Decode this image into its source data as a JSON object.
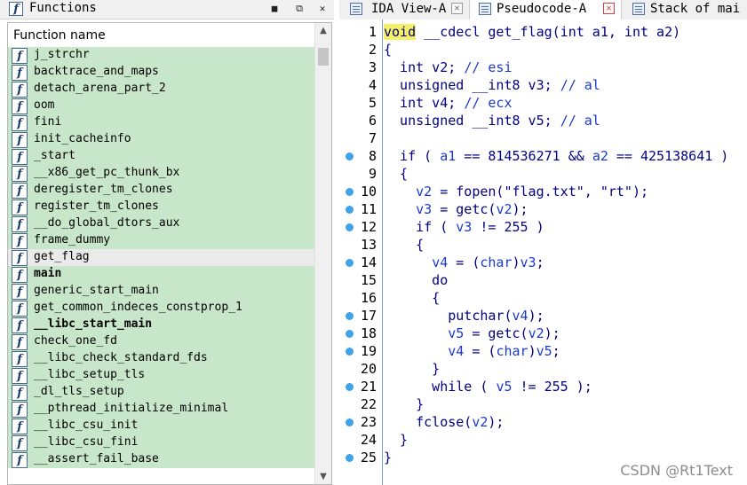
{
  "left_panel": {
    "title": "Functions",
    "column_header": "Function name",
    "icon_glyph": "f",
    "functions": [
      {
        "name": "j_strchr",
        "bold": false
      },
      {
        "name": "backtrace_and_maps",
        "bold": false
      },
      {
        "name": "detach_arena_part_2",
        "bold": false
      },
      {
        "name": "oom",
        "bold": false
      },
      {
        "name": "fini",
        "bold": false
      },
      {
        "name": "init_cacheinfo",
        "bold": false
      },
      {
        "name": "_start",
        "bold": false
      },
      {
        "name": "__x86_get_pc_thunk_bx",
        "bold": false
      },
      {
        "name": "deregister_tm_clones",
        "bold": false
      },
      {
        "name": "register_tm_clones",
        "bold": false
      },
      {
        "name": "__do_global_dtors_aux",
        "bold": false
      },
      {
        "name": "frame_dummy",
        "bold": false
      },
      {
        "name": "get_flag",
        "bold": false,
        "selected": true
      },
      {
        "name": "main",
        "bold": true
      },
      {
        "name": "generic_start_main",
        "bold": false
      },
      {
        "name": "get_common_indeces_constprop_1",
        "bold": false
      },
      {
        "name": "__libc_start_main",
        "bold": true
      },
      {
        "name": "check_one_fd",
        "bold": false
      },
      {
        "name": "__libc_check_standard_fds",
        "bold": false
      },
      {
        "name": "__libc_setup_tls",
        "bold": false
      },
      {
        "name": "_dl_tls_setup",
        "bold": false
      },
      {
        "name": "__pthread_initialize_minimal",
        "bold": false
      },
      {
        "name": "__libc_csu_init",
        "bold": false
      },
      {
        "name": "__libc_csu_fini",
        "bold": false
      },
      {
        "name": "__assert_fail_base",
        "bold": false
      }
    ]
  },
  "tabs": [
    {
      "label": "IDA View-A",
      "active": false
    },
    {
      "label": "Pseudocode-A",
      "active": true
    },
    {
      "label": "Stack of mai",
      "active": false
    }
  ],
  "code": [
    {
      "n": "1",
      "bp": false,
      "html": "<span class=\"hl\">void</span> __cdecl get_flag(int a1, int a2)"
    },
    {
      "n": "2",
      "bp": false,
      "html": "{"
    },
    {
      "n": "3",
      "bp": false,
      "html": "  int v2; <span class=\"cm\">// esi</span>"
    },
    {
      "n": "4",
      "bp": false,
      "html": "  unsigned __int8 v3; <span class=\"cm\">// al</span>"
    },
    {
      "n": "5",
      "bp": false,
      "html": "  int v4; <span class=\"cm\">// ecx</span>"
    },
    {
      "n": "6",
      "bp": false,
      "html": "  unsigned __int8 v5; <span class=\"cm\">// al</span>"
    },
    {
      "n": "7",
      "bp": false,
      "html": ""
    },
    {
      "n": "8",
      "bp": true,
      "html": "  if ( <span class=\"var\">a1</span> == 814536271 &amp;&amp; <span class=\"var\">a2</span> == 425138641 )"
    },
    {
      "n": "9",
      "bp": false,
      "html": "  {"
    },
    {
      "n": "10",
      "bp": true,
      "html": "    <span class=\"var\">v2</span> = fopen(\"flag.txt\", \"rt\");"
    },
    {
      "n": "11",
      "bp": true,
      "html": "    <span class=\"var\">v3</span> = getc(<span class=\"var\">v2</span>);"
    },
    {
      "n": "12",
      "bp": true,
      "html": "    if ( <span class=\"var\">v3</span> != 255 )"
    },
    {
      "n": "13",
      "bp": false,
      "html": "    {"
    },
    {
      "n": "14",
      "bp": true,
      "html": "      <span class=\"var\">v4</span> = (<span class=\"var\">char</span>)<span class=\"var\">v3</span>;"
    },
    {
      "n": "15",
      "bp": false,
      "html": "      do"
    },
    {
      "n": "16",
      "bp": false,
      "html": "      {"
    },
    {
      "n": "17",
      "bp": true,
      "html": "        putchar(<span class=\"var\">v4</span>);"
    },
    {
      "n": "18",
      "bp": true,
      "html": "        <span class=\"var\">v5</span> = getc(<span class=\"var\">v2</span>);"
    },
    {
      "n": "19",
      "bp": true,
      "html": "        <span class=\"var\">v4</span> = (<span class=\"var\">char</span>)<span class=\"var\">v5</span>;"
    },
    {
      "n": "20",
      "bp": false,
      "html": "      }"
    },
    {
      "n": "21",
      "bp": true,
      "html": "      while ( <span class=\"var\">v5</span> != 255 );"
    },
    {
      "n": "22",
      "bp": false,
      "html": "    }"
    },
    {
      "n": "23",
      "bp": true,
      "html": "    fclose(<span class=\"var\">v2</span>);"
    },
    {
      "n": "24",
      "bp": false,
      "html": "  }"
    },
    {
      "n": "25",
      "bp": true,
      "html": "}"
    }
  ],
  "watermark": "CSDN @Rt1Text",
  "colors": {
    "function_row_bg": "#c8e6c9",
    "selected_row_bg": "#eaeaea",
    "code_text": "#000080",
    "variable_text": "#1b39c8",
    "breakpoint_dot": "#3fa3e6",
    "keyword_highlight": "#f5f068"
  }
}
